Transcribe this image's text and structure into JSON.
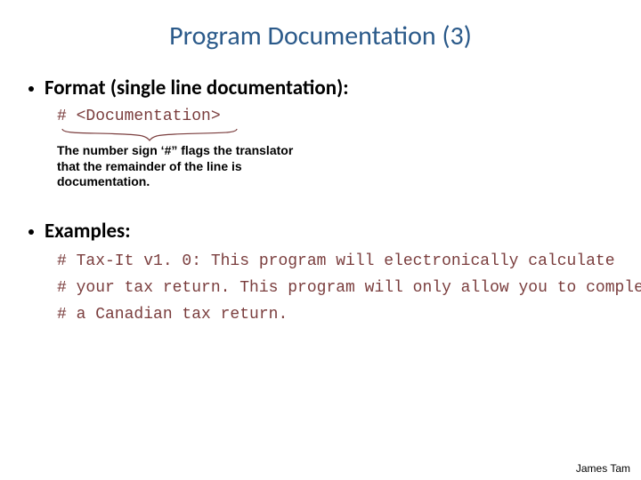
{
  "title": "Program Documentation (3)",
  "bullets": {
    "format": "Format (single line documentation):",
    "examples": "Examples:"
  },
  "format_code": "# <Documentation>",
  "caption": "The number sign ‘#” flags the translator that the remainder of the line is documentation.",
  "example_lines": {
    "l1": "# Tax-It v1. 0: This program will electronically calculate",
    "l2": "# your tax return. This program will only allow you to complete",
    "l3": "# a Canadian tax return."
  },
  "footer": "James Tam"
}
